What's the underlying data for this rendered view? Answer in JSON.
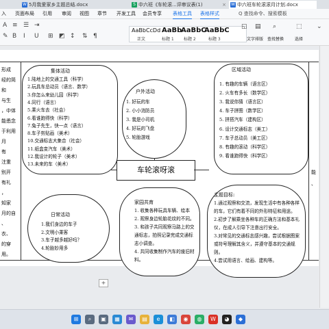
{
  "tabs": [
    {
      "label": "5月我爱家乡主题总结.docx",
      "icon_color": "#2b6fd6",
      "icon_letter": "W"
    },
    {
      "label": "中六班《车轮滚...评审议表(1)",
      "icon_color": "#1aa260",
      "icon_letter": "S"
    },
    {
      "label": "中六班车轮滚滚月计划.docx",
      "icon_color": "#2b6fd6",
      "icon_letter": "W"
    }
  ],
  "menu": [
    "入",
    "页面布局",
    "引用",
    "审阅",
    "视图",
    "章节",
    "开发工具",
    "会员专享",
    "表格工具",
    "表格样式"
  ],
  "ribbon": {
    "style_samples": [
      {
        "preview": "AaBbCcDd",
        "name": "正文"
      },
      {
        "preview": "AaBb",
        "name": "标题 1"
      },
      {
        "preview": "AaBbC",
        "name": "标题 2"
      },
      {
        "preview": "AaBbC",
        "name": "标题 3"
      }
    ],
    "search_placeholder": "Q 查找命令、搜索模板",
    "text_layout": "文字排版",
    "find_replace": "查找替换",
    "select": "选择"
  },
  "center_title": "车轮滚呀滚",
  "collective": {
    "title": "集体活动",
    "items": [
      "1.陆地上的交通工具（科学）",
      "2.玩具车总动员（语言、数学）",
      "3.你怎么来幼儿园（科学）",
      "4.同行（语言）",
      "5.乘火车去（社会）",
      "6.看谁跑得快（科学）",
      "7.兔子先生，快一点（语言）",
      "8.车子剪贴画（美术）",
      "10.交通标志大集合（社会）",
      "11.纸盒变汽车（美术）",
      "12.我设计的轮子（美术）",
      "13.未来的车（美术）"
    ]
  },
  "outdoor": {
    "title": "户外活动",
    "items": [
      "1.  好玩的车",
      "2.  小小消防员",
      "3.  我是小司机",
      "4.  好玩的飞盘",
      "5.  轮胎游戏"
    ]
  },
  "area": {
    "title": "区域活动",
    "items": [
      "1.  有趣的车辆（语言区）",
      "2.  火车有多长（数学区）",
      "3.  我说你猜（语言区）",
      "4.  车子拼图（数学区）",
      "5.  拼搭汽车（建构区）",
      "6.  设计交通标志（美工）",
      "7.  车子总动员（美工区）",
      "8.  有趣的滚动（科学区）",
      "9.  看谁跑得快（科学区）"
    ]
  },
  "daily": {
    "title": "日常活动",
    "items": [
      "1.我们身边的车子",
      "2.文明小乘客",
      "3.车子越多越好吗？",
      "4.轮胎妙用多"
    ]
  },
  "family": {
    "title": "家园共育",
    "text": "1. 收集各种玩具车辆、绘本\n2. 观察身边轮胎花纹的不同。\n3. 和孩子共同观察马路上的交通标志，拍照记录完成交通标志小调查。\n4. 共同收集制作汽车的废旧材料。"
  },
  "goals": {
    "title": "主题目标:",
    "text": "1.通过观察和交流，发现生活中有各种各样的车，它们有着不同的外形特征和用途。\n2.初步了解乘坐各种车的正确方法和基本礼仪，在成人引导下注意出行安全。\n3.对常见的交通标志感兴趣，尝试根据图案或符号理解其含义，并遵守基本的交通规则。\n4.尝试用语言、绘画、建构等。"
  },
  "left_cut": [
    "形成",
    "经的简",
    "和",
    "与生",
    "，中体",
    "能悉念",
    "于利用",
    "月",
    "有",
    "注重",
    "别开",
    "有礼",
    "，",
    "知家",
    "月的自",
    "、",
    "衣、",
    "的穿",
    "用。"
  ],
  "right_cut": [
    "能",
    "、"
  ],
  "taskbar_icons": [
    {
      "name": "windows-start-icon",
      "color": "#1f7ae0",
      "glyph": "⊞"
    },
    {
      "name": "search-taskbar-icon",
      "color": "#5a6b80",
      "glyph": "⌕"
    },
    {
      "name": "task-view-icon",
      "color": "#5a6b80",
      "glyph": "▣"
    },
    {
      "name": "widgets-icon",
      "color": "#2a8ad4",
      "glyph": "▦"
    },
    {
      "name": "chat-icon",
      "color": "#6a5acd",
      "glyph": "✉"
    },
    {
      "name": "file-explorer-icon",
      "color": "#e7b23a",
      "glyph": "▤"
    },
    {
      "name": "edge-browser-icon",
      "color": "#1b8fd8",
      "glyph": "e"
    },
    {
      "name": "store-icon",
      "color": "#3d7bd8",
      "glyph": "◧"
    },
    {
      "name": "chrome-browser-icon",
      "color": "#d9453b",
      "glyph": "◉"
    },
    {
      "name": "wechat-icon",
      "color": "#2aae67",
      "glyph": "◍"
    },
    {
      "name": "wps-office-icon",
      "color": "#d93025",
      "glyph": "W"
    },
    {
      "name": "qq-icon",
      "color": "#222",
      "glyph": "◕"
    },
    {
      "name": "app-blue-icon",
      "color": "#2b6fd6",
      "glyph": "◆"
    }
  ]
}
